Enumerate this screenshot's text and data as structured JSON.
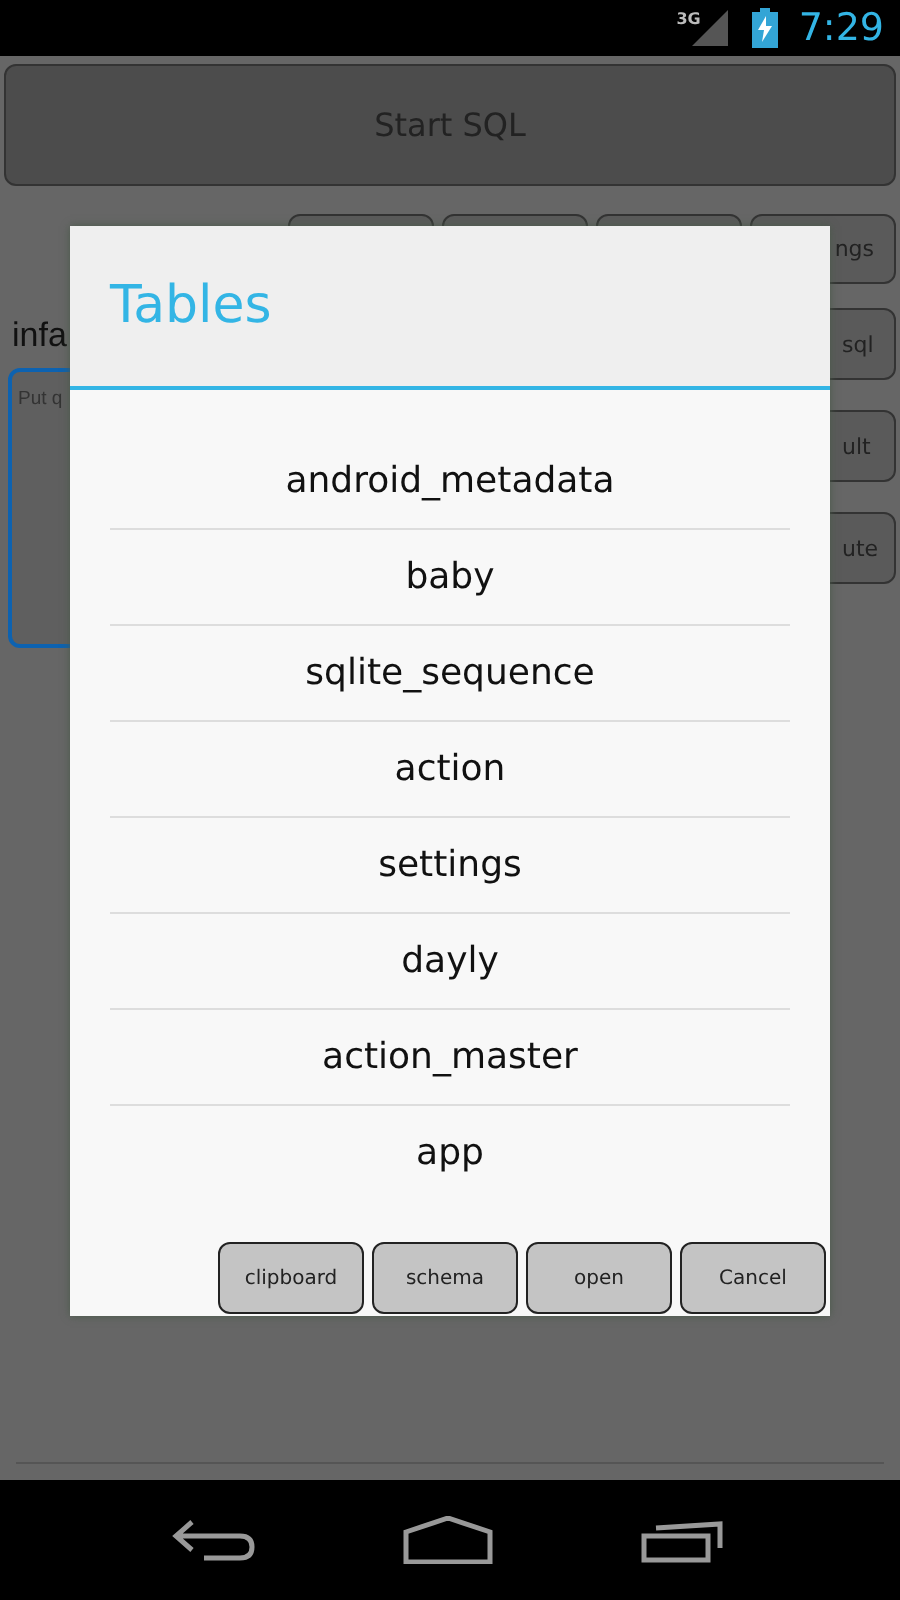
{
  "status_bar": {
    "network": "3G",
    "time": "7:29"
  },
  "main": {
    "start_button": "Start SQL",
    "top_button": "ngs",
    "label": "infa",
    "query_placeholder": "Put q",
    "side_buttons": [
      "sql",
      "ult",
      "ute"
    ]
  },
  "dialog": {
    "title": "Tables",
    "items": [
      "android_metadata",
      "baby",
      "sqlite_sequence",
      "action",
      "settings",
      "dayly",
      "action_master",
      "app"
    ],
    "buttons": [
      "clipboard",
      "schema",
      "open",
      "Cancel"
    ]
  }
}
